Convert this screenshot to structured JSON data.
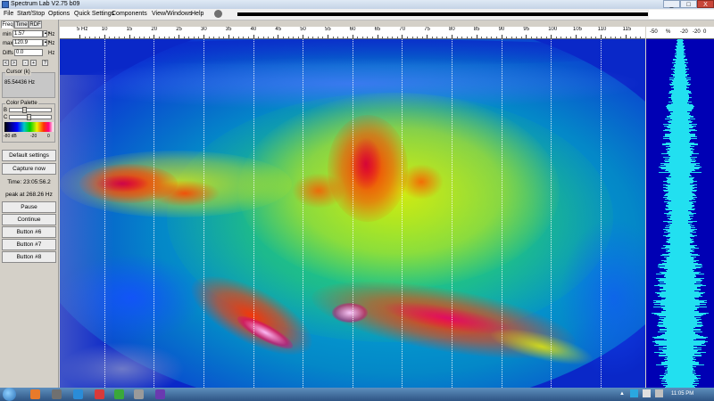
{
  "window": {
    "title": "Spectrum Lab V2.75 b09",
    "buttons": [
      "_",
      "□",
      "X"
    ]
  },
  "menu": {
    "items": [
      "File",
      "Start/Stop",
      "Options",
      "Quick Settings",
      "Components",
      "View/Windows",
      "Help"
    ],
    "underline": [
      "F",
      "S",
      "O",
      "Q",
      "C",
      "V",
      "H"
    ]
  },
  "left_panel": {
    "tabs": [
      "Freq",
      "Time",
      "RDF"
    ],
    "min_label": "min",
    "min_value": "1.57",
    "min_unit": "Hz",
    "max_label": "max",
    "max_value": "120.9",
    "max_unit": "Hz",
    "diff_label": "Diffs",
    "diff_value": "0.0",
    "diff_unit": "Hz",
    "step_buttons": [
      "<",
      ">",
      "-",
      "+",
      "?"
    ],
    "cursor_title": "Cursor (k)",
    "cursor_value": "85.54436 Hz",
    "palette_title": "Color Palette",
    "palette_b": "B",
    "palette_c": "C",
    "palette_scale": [
      "-80 dB",
      "-20",
      "0"
    ],
    "buttons": [
      "Default settings",
      "Capture now",
      "Time:  23:05:56.2",
      "peak at 268.26 Hz",
      "Pause",
      "Continue",
      "Button #6",
      "Button #7",
      "Button #8"
    ]
  },
  "freq_scale": {
    "ticks": [
      "5 Hz",
      "10",
      "15",
      "20",
      "25",
      "30",
      "35",
      "40",
      "45",
      "50",
      "55",
      "60",
      "65",
      "70",
      "75",
      "80",
      "85",
      "90",
      "95",
      "100",
      "105",
      "110",
      "115"
    ],
    "unit": "Hz"
  },
  "right_scale": {
    "ticks": [
      "-50",
      "%",
      "-20",
      "-20",
      "0"
    ]
  },
  "spectrogram": {
    "description_colors": {
      "background": "#0a28c8",
      "low": "#1450ff",
      "mid_low": "#00c8c8",
      "mid": "#3cdc3c",
      "mid_high": "#f0f000",
      "high": "#ff3c00",
      "peak": "#ff0080",
      "max": "#ffd0ff"
    }
  },
  "taskbar": {
    "clock": "11:05 PM"
  },
  "colors": {
    "window_bg": "#d4d0c8",
    "accent": "#2e5584",
    "spectrum_line": "#22e0f0"
  }
}
